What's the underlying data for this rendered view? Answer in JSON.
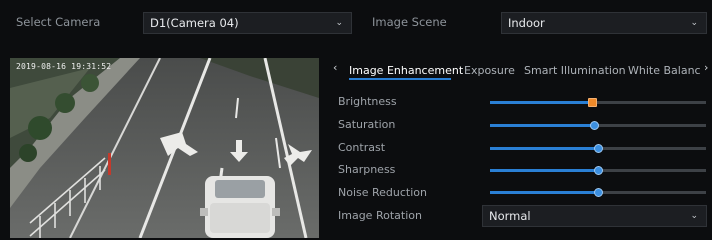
{
  "camera": {
    "label": "Select Camera",
    "value": "D1(Camera 04)"
  },
  "scene": {
    "label": "Image Scene",
    "value": "Indoor"
  },
  "video": {
    "timestamp": "2019-08-16 19:31:52"
  },
  "tabs": [
    {
      "label": "Image Enhancement",
      "active": true
    },
    {
      "label": "Exposure",
      "active": false
    },
    {
      "label": "Smart Illumination",
      "active": false
    },
    {
      "label": "White Balanc",
      "active": false
    }
  ],
  "nav": {
    "prev": "‹",
    "next": "›"
  },
  "params": [
    {
      "label": "Brightness",
      "level": 0.47,
      "knob": "square"
    },
    {
      "label": "Saturation",
      "level": 0.48,
      "knob": "round"
    },
    {
      "label": "Contrast",
      "level": 0.5,
      "knob": "round"
    },
    {
      "label": "Sharpness",
      "level": 0.5,
      "knob": "round"
    },
    {
      "label": "Noise Reduction",
      "level": 0.5,
      "knob": "round"
    }
  ],
  "rotation": {
    "label": "Image Rotation",
    "value": "Normal"
  },
  "colors": {
    "accent": "#2a7fd4",
    "brightness_knob": "#f08a2a"
  }
}
